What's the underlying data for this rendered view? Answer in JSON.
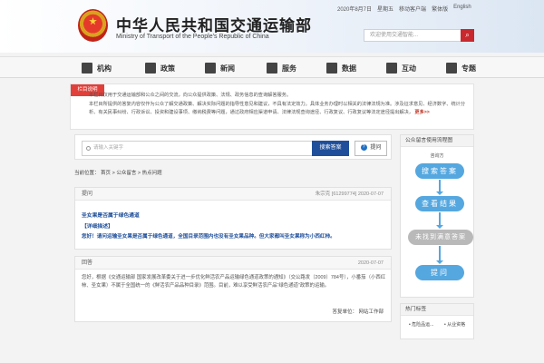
{
  "header": {
    "title_cn": "中华人民共和国交通运输部",
    "title_en": "Ministry of Transport of the People's Republic of China",
    "date": "2020年8月7日",
    "weekday": "星期五",
    "links": [
      "移动客户端",
      "繁体版",
      "English"
    ],
    "search_placeholder": "欢迎使用交通智能..."
  },
  "nav": {
    "items": [
      {
        "label": "机构",
        "icon": "building-icon"
      },
      {
        "label": "政策",
        "icon": "document-icon"
      },
      {
        "label": "新闻",
        "icon": "newspaper-icon"
      },
      {
        "label": "服务",
        "icon": "service-icon"
      },
      {
        "label": "数据",
        "icon": "chart-icon"
      },
      {
        "label": "互动",
        "icon": "chat-icon"
      },
      {
        "label": "专题",
        "icon": "bookmark-icon"
      }
    ]
  },
  "notice": {
    "tag": "栏目说明",
    "line1": "本栏目仅用于交通运输部和公众之间的交流，向公众提供政策、法规、政务信息的查询解答服务。",
    "line2": "本栏目所提供的答复内容仅作为公众了解交通政策、解决实际问题的指导性意见和建议，不具有法定效力。具体业务办理时以相关的法律法规为准。涉及征求意见、经济数字、统计分析、有关民事纠纷、行政诉讼、投资和建设事项、缴纳税费等问题，通过政府相应渠道申请、法律法规查询途径、行政复议、行政复议等法定途径提出解决，",
    "more": "更多>>"
  },
  "search": {
    "placeholder": "请输入关键字",
    "search_button": "搜索答案",
    "ask_button": "提问",
    "ask_icon": "?"
  },
  "breadcrumb": {
    "prefix": "当前位置：",
    "items": [
      "首页",
      "公众留言",
      "热点问题"
    ],
    "separator": " > "
  },
  "question": {
    "label": "提问",
    "meta": "朱宗克  [61299774]  2020-07-07",
    "title": "圣女果是否属于绿色通道",
    "detail_label": "【详细描述】",
    "body": "您好！请问运输圣女果是否属于绿色通道，全国目录范围内也没有圣女果品种。但大家都叫圣女果称为小西红柿。"
  },
  "answer": {
    "label": "回答",
    "date": "2020-07-07",
    "body": "您好，根据《交通运输部 国家发展改革委关于进一步优化鲜活农产品运输绿色通道政策的通知》（交公路发〔2009〕784号），小番茄（小西红柿、圣女果）不属于全国统一的《鲜活农产品品种目录》范围。目前，难以享受鲜活农产品“绿色通道”政策的运输。",
    "signature": "答复单位：  网站工作部"
  },
  "flow": {
    "title": "公众留言使用流程图",
    "user_label": "咨询方",
    "steps": [
      "搜索答案",
      "查看结果",
      "未找到满意答案",
      "提问"
    ]
  },
  "hot": {
    "title": "热门标签",
    "tags": [
      "危险品运...",
      "从业资格"
    ]
  }
}
